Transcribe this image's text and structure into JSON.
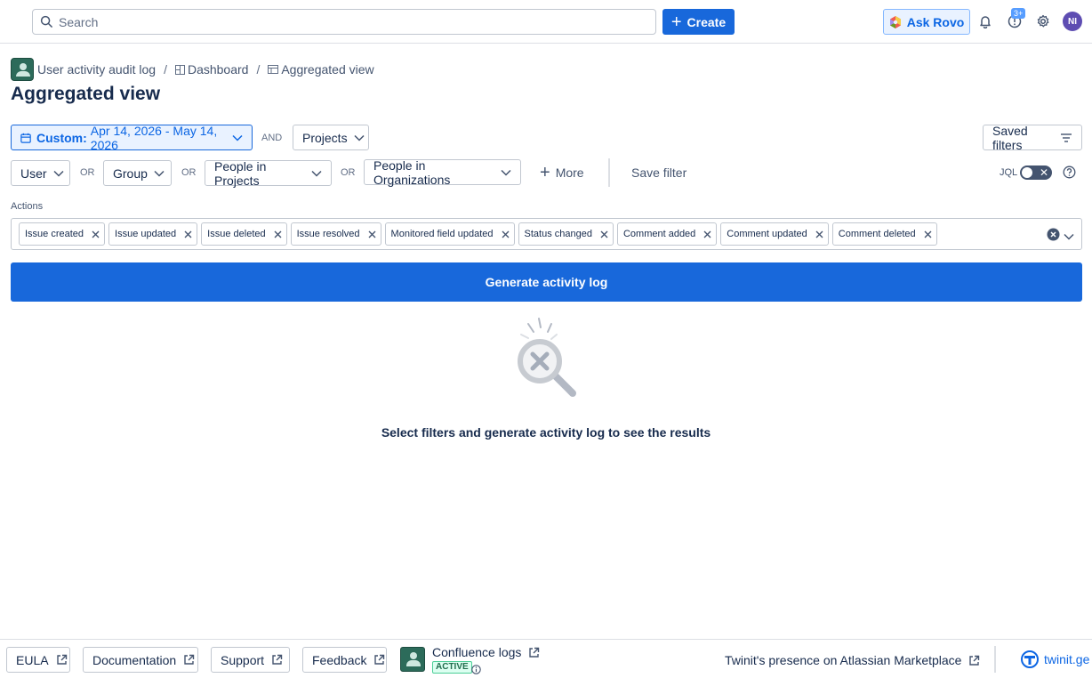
{
  "topbar": {
    "search_placeholder": "Search",
    "create_label": "Create",
    "rovo_label": "Ask Rovo",
    "notifications_badge": "3+",
    "avatar_initials": "NI"
  },
  "breadcrumb": {
    "items": [
      "User activity audit log",
      "Dashboard",
      "Aggregated view"
    ],
    "separator": "/"
  },
  "page_title": "Aggregated view",
  "filters": {
    "date_prefix": "Custom:",
    "date_range": "Apr 14, 2026 - May 14, 2026",
    "and_label": "AND",
    "projects_label": "Projects",
    "saved_filters_label": "Saved filters",
    "user_label": "User",
    "or_label": "OR",
    "group_label": "Group",
    "people_in_projects_label": "People in Projects",
    "people_in_orgs_label": "People in Organizations",
    "more_label": "More",
    "save_filter_label": "Save filter",
    "jql_label": "JQL"
  },
  "actions": {
    "label": "Actions",
    "chips": [
      "Issue created",
      "Issue updated",
      "Issue deleted",
      "Issue resolved",
      "Monitored field updated",
      "Status changed",
      "Comment added",
      "Comment updated",
      "Comment deleted"
    ]
  },
  "generate_label": "Generate activity log",
  "empty_state_text": "Select filters and generate activity log to see the results",
  "footer": {
    "eula": "EULA",
    "documentation": "Documentation",
    "support": "Support",
    "feedback": "Feedback",
    "confluence_logs": "Confluence logs",
    "active_badge": "ACTIVE",
    "marketplace": "Twinit's presence on Atlassian Marketplace",
    "brand": "twinit.ge"
  },
  "colors": {
    "primary": "#1868db",
    "active_green": "#4bce97",
    "avatar": "#5e4db2"
  }
}
